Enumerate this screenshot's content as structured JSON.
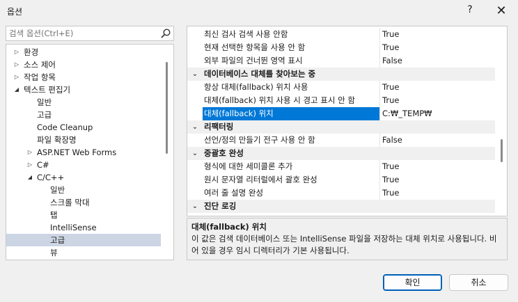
{
  "window": {
    "title": "옵션",
    "help_glyph": "?",
    "close_glyph": "✕"
  },
  "search": {
    "placeholder": "검색 옵션(Ctrl+E)",
    "value": ""
  },
  "tree": {
    "items": [
      {
        "label": "환경",
        "arrow": "▷"
      },
      {
        "label": "소스 제어",
        "arrow": "▷"
      },
      {
        "label": "작업 항목",
        "arrow": "▷"
      },
      {
        "label": "텍스트 편집기",
        "arrow": "◢"
      },
      {
        "label": "일반",
        "arrow": ""
      },
      {
        "label": "고급",
        "arrow": ""
      },
      {
        "label": "Code Cleanup",
        "arrow": ""
      },
      {
        "label": "파일 확장명",
        "arrow": ""
      },
      {
        "label": "ASP.NET Web Forms",
        "arrow": "▷"
      },
      {
        "label": "C#",
        "arrow": "▷"
      },
      {
        "label": "C/C++",
        "arrow": "◢"
      },
      {
        "label": "일반",
        "arrow": ""
      },
      {
        "label": "스크롤 막대",
        "arrow": ""
      },
      {
        "label": "탭",
        "arrow": ""
      },
      {
        "label": "IntelliSense",
        "arrow": ""
      },
      {
        "label": "고급",
        "arrow": "",
        "selected": true
      },
      {
        "label": "뷰",
        "arrow": ""
      }
    ]
  },
  "grid": {
    "rows": [
      {
        "name": "최신 검사 검색 사용 안함",
        "value": "True"
      },
      {
        "name": "현재 선택한 항목을 사용 안 함",
        "value": "True"
      },
      {
        "name": "외부 파일의 건너뛴 영역 표시",
        "value": "False"
      },
      {
        "category": true,
        "name": "데이터베이스 대체를 찾아보는 중",
        "arrow": "⌄"
      },
      {
        "name": "항상 대체(fallback) 위치 사용",
        "value": "True"
      },
      {
        "name": "대체(fallback) 위치 사용 시 경고 표시 안 함",
        "value": "True"
      },
      {
        "name": "대체(fallback) 위치",
        "value": "C:₩_TEMP₩",
        "selected": true
      },
      {
        "category": true,
        "name": "리팩터링",
        "arrow": "⌄"
      },
      {
        "name": "선언/정의 만들기 전구 사용 안 함",
        "value": "False"
      },
      {
        "category": true,
        "name": "중괄호 완성",
        "arrow": "⌄"
      },
      {
        "name": "형식에 대한 세미콜론 추가",
        "value": "True"
      },
      {
        "name": "원시 문자열 리터럴에서 괄호 완성",
        "value": "True"
      },
      {
        "name": "여러 줄 설명 완성",
        "value": "True"
      },
      {
        "category": true,
        "name": "진단 로깅",
        "arrow": "⌄"
      }
    ]
  },
  "description": {
    "title": "대체(fallback) 위치",
    "text": "이 값은 검색 데이터베이스 또는 IntelliSense 파일을 저장하는 대체 위치로 사용됩니다. 비어 있을 경우 임시 디렉터리가 기본 사용됩니다."
  },
  "buttons": {
    "ok": "확인",
    "cancel": "취소"
  },
  "colors": {
    "selection_blue": "#0078d7",
    "tree_selection": "#ccd5e3",
    "primary_border": "#005fb8"
  }
}
